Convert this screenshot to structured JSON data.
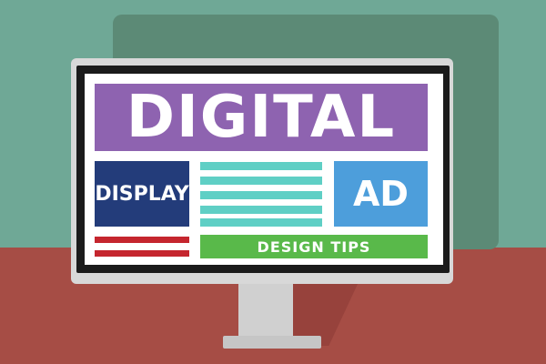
{
  "colors": {
    "wall": "#6fa896",
    "floor": "#a64d45",
    "purple": "#8e63b0",
    "navy": "#233c7a",
    "blue": "#4d9edb",
    "teal": "#5fcfc5",
    "red": "#c5262e",
    "green": "#59b94a"
  },
  "banner": {
    "title": "DIGITAL",
    "left_box": "DISPLAY",
    "right_box": "AD",
    "bottom_bar": "DESIGN TIPS"
  }
}
